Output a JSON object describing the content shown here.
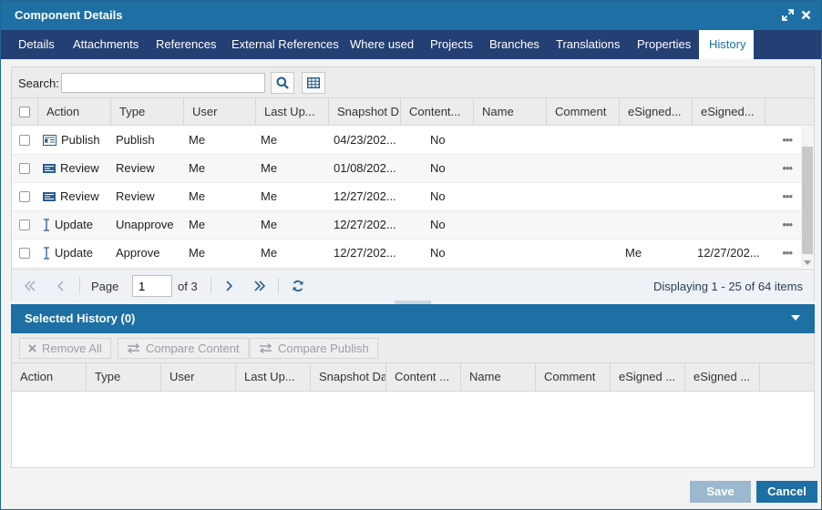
{
  "window": {
    "title": "Component Details"
  },
  "tabs": [
    "Details",
    "Attachments",
    "References",
    "External References",
    "Where used",
    "Projects",
    "Branches",
    "Translations",
    "Properties",
    "History"
  ],
  "active_tab": "History",
  "search": {
    "label": "Search:",
    "value": "",
    "placeholder": ""
  },
  "history_columns": [
    "Action",
    "Type",
    "User",
    "Last Up...",
    "Snapshot D",
    "Content...",
    "Name",
    "Comment",
    "eSigned...",
    "eSigned..."
  ],
  "history_rows": [
    {
      "action": "Publish",
      "icon": "publish-icon",
      "type": "Publish",
      "user": "Me",
      "last_updated_by": "Me",
      "snapshot_date": "04/23/202...",
      "content": "No",
      "name": "",
      "comment": "",
      "esigned_by": "",
      "esigned_date": ""
    },
    {
      "action": "Review",
      "icon": "review-icon",
      "type": "Review",
      "user": "Me",
      "last_updated_by": "Me",
      "snapshot_date": "01/08/202...",
      "content": "No",
      "name": "",
      "comment": "",
      "esigned_by": "",
      "esigned_date": ""
    },
    {
      "action": "Review",
      "icon": "review-icon",
      "type": "Review",
      "user": "Me",
      "last_updated_by": "Me",
      "snapshot_date": "12/27/202...",
      "content": "No",
      "name": "",
      "comment": "",
      "esigned_by": "",
      "esigned_date": ""
    },
    {
      "action": "Update",
      "icon": "text-cursor-icon",
      "type": "Unapprove",
      "user": "Me",
      "last_updated_by": "Me",
      "snapshot_date": "12/27/202...",
      "content": "No",
      "name": "",
      "comment": "",
      "esigned_by": "",
      "esigned_date": ""
    },
    {
      "action": "Update",
      "icon": "text-cursor-icon",
      "type": "Approve",
      "user": "Me",
      "last_updated_by": "Me",
      "snapshot_date": "12/27/202...",
      "content": "No",
      "name": "",
      "comment": "",
      "esigned_by": "Me",
      "esigned_date": "12/27/202..."
    }
  ],
  "row_menu": "•••",
  "pager": {
    "page_label": "Page",
    "page_value": "1",
    "of_label": "of 3",
    "info": "Displaying 1 - 25 of 64 items"
  },
  "selected": {
    "title": "Selected History (0)",
    "toolbar": {
      "remove_all": "Remove All",
      "compare_content": "Compare Content",
      "compare_publish": "Compare Publish"
    },
    "columns": [
      "Action",
      "Type",
      "User",
      "Last Up...",
      "Snapshot Da",
      "Content ...",
      "Name",
      "Comment",
      "eSigned ...",
      "eSigned ..."
    ]
  },
  "footer": {
    "save": "Save",
    "cancel": "Cancel"
  },
  "colors": {
    "titlebar": "#1e6fa3",
    "tabbar": "#243f73",
    "accent": "#1e6fa3",
    "save_disabled": "#9bb8cf"
  }
}
